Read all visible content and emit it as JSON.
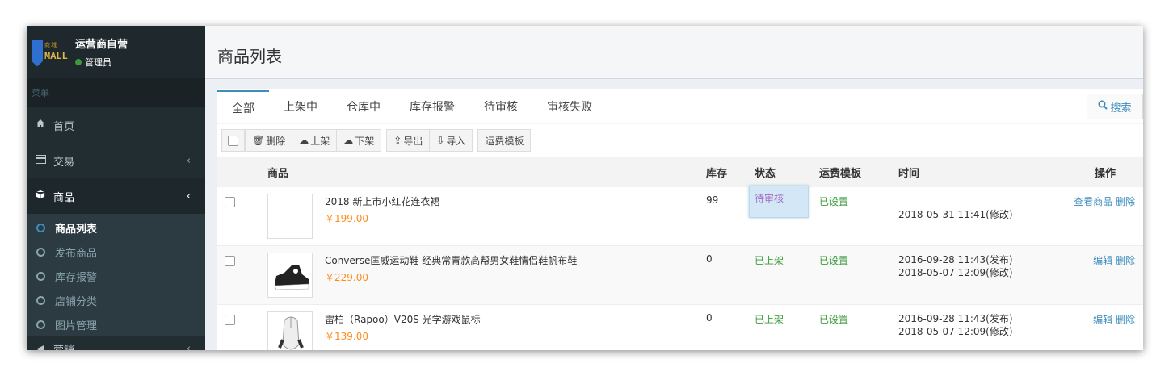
{
  "sidebar": {
    "logo_top": "商城",
    "logo_main": "MALL",
    "shop_name": "运营商自营",
    "role": "管理员",
    "section_label": "菜单",
    "items": [
      {
        "label": "首页",
        "icon": "home-icon"
      },
      {
        "label": "交易",
        "icon": "card-icon"
      },
      {
        "label": "商品",
        "icon": "cube-icon"
      }
    ],
    "subitems": [
      "商品列表",
      "发布商品",
      "库存报警",
      "店铺分类",
      "图片管理"
    ],
    "bottom_item": "营销"
  },
  "page": {
    "title": "商品列表"
  },
  "tabs": [
    "全部",
    "上架中",
    "仓库中",
    "库存报警",
    "待审核",
    "审核失败"
  ],
  "search_label": "搜索",
  "toolbar": {
    "delete": "删除",
    "on_shelf": "上架",
    "off_shelf": "下架",
    "export": "导出",
    "import": "导入",
    "shipping_template": "运费模板"
  },
  "table": {
    "headers": {
      "product": "商品",
      "stock": "库存",
      "status": "状态",
      "shipping": "运费模板",
      "time": "时间",
      "actions": "操作"
    },
    "rows": [
      {
        "title": "2018 新上市小红花连衣裙",
        "price": "￥199.00",
        "stock": "99",
        "status": "待审核",
        "shipping": "已设置",
        "time1": "",
        "time2": "2018-05-31 11:41(修改)",
        "action1": "查看商品",
        "action2": "删除"
      },
      {
        "title": "Converse匡威运动鞋 经典常青款高帮男女鞋情侣鞋帆布鞋",
        "price": "￥229.00",
        "stock": "0",
        "status": "已上架",
        "shipping": "已设置",
        "time1": "2016-09-28 11:43(发布)",
        "time2": "2018-05-07 12:09(修改)",
        "action1": "编辑",
        "action2": "删除"
      },
      {
        "title": "雷柏（Rapoo）V20S 光学游戏鼠标",
        "price": "￥139.00",
        "stock": "0",
        "status": "已上架",
        "shipping": "已设置",
        "time1": "2016-09-28 11:43(发布)",
        "time2": "2018-05-07 12:09(修改)",
        "action1": "编辑",
        "action2": "删除"
      }
    ]
  }
}
